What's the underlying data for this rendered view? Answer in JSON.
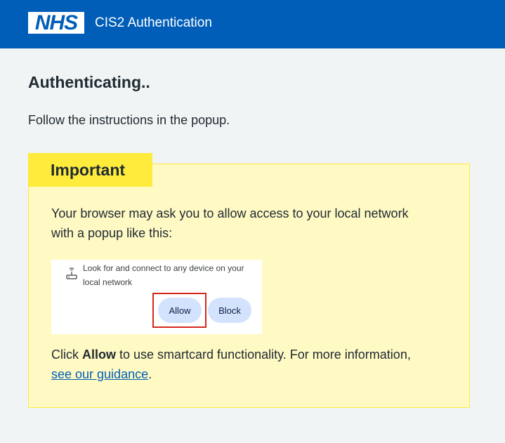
{
  "header": {
    "logo_text": "NHS",
    "service_name": "CIS2 Authentication"
  },
  "main": {
    "title": "Authenticating..",
    "instructions": "Follow the instructions in the popup."
  },
  "callout": {
    "label": "Important",
    "text": "Your browser may ask you to allow access to your local network with a popup like this:",
    "popup": {
      "icon": "network-device-icon",
      "message": "Look for and connect to any device on your local network",
      "allow_label": "Allow",
      "block_label": "Block"
    },
    "closing": {
      "prefix": "Click ",
      "bold": "Allow",
      "middle": " to use smartcard functionality. For more information, ",
      "link_text": "see our guidance",
      "suffix": "."
    }
  },
  "colors": {
    "header_bg": "#005eb8",
    "callout_bg": "#fff9c4",
    "callout_label_bg": "#ffeb3b",
    "highlight_border": "#d5281b"
  }
}
